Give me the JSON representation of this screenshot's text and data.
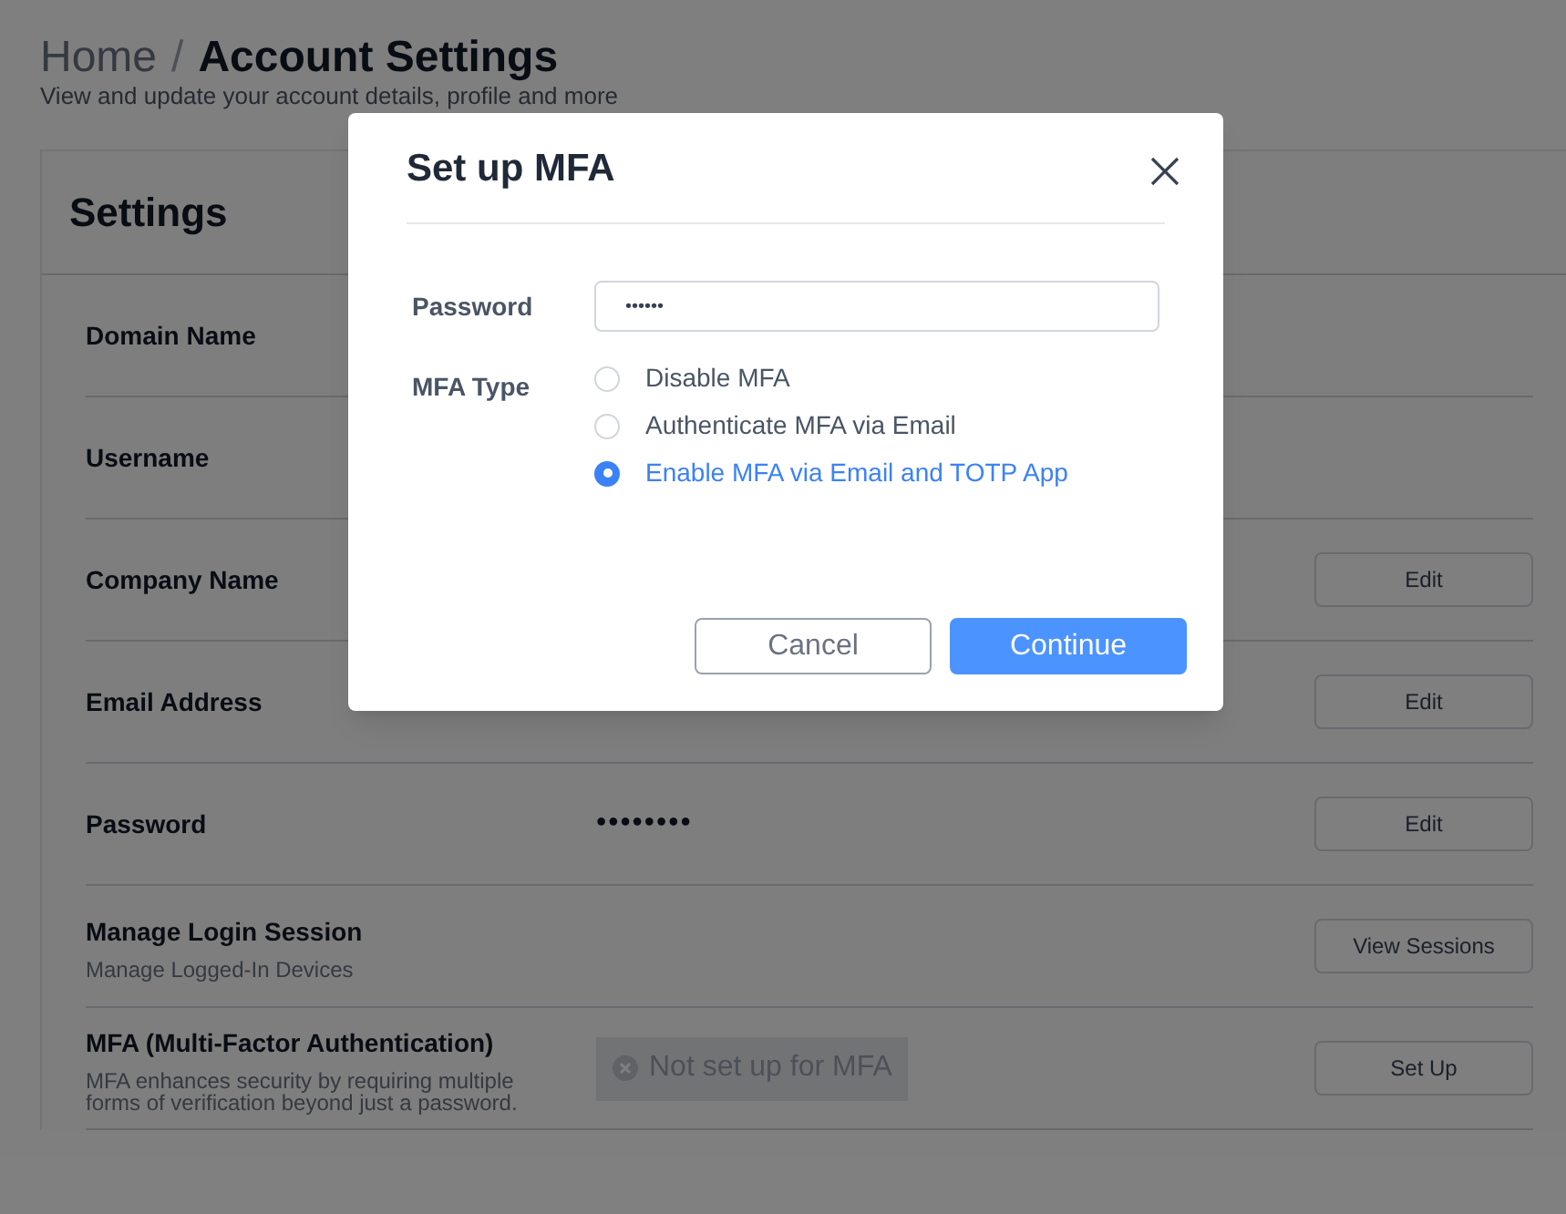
{
  "breadcrumb": {
    "home": "Home",
    "separator": "/",
    "current": "Account Settings"
  },
  "subtitle": "View and update your account details, profile and more",
  "settings": {
    "title": "Settings",
    "rows": [
      {
        "label": "Domain Name"
      },
      {
        "label": "Username"
      },
      {
        "label": "Company Name",
        "button": "Edit"
      },
      {
        "label": "Email Address",
        "button": "Edit"
      },
      {
        "label": "Password",
        "value": "••••••••",
        "button": "Edit"
      },
      {
        "label": "Manage Login Session",
        "description": "Manage Logged-In Devices",
        "button": "View Sessions"
      },
      {
        "label": "MFA (Multi-Factor Authentication)",
        "description": "MFA enhances security by requiring multiple forms of verification beyond just a password.",
        "badge": "Not set up for MFA",
        "button": "Set Up"
      }
    ]
  },
  "dialog": {
    "title": "Set up MFA",
    "password_label": "Password",
    "password_value": "••••••",
    "mfa_type_label": "MFA Type",
    "options": [
      {
        "label": "Disable MFA",
        "selected": false
      },
      {
        "label": "Authenticate MFA via Email",
        "selected": false
      },
      {
        "label": "Enable MFA via Email and TOTP App",
        "selected": true
      }
    ],
    "buttons": [
      {
        "label": "Cancel",
        "kind": "secondary"
      },
      {
        "label": "Continue",
        "kind": "primary"
      }
    ]
  }
}
